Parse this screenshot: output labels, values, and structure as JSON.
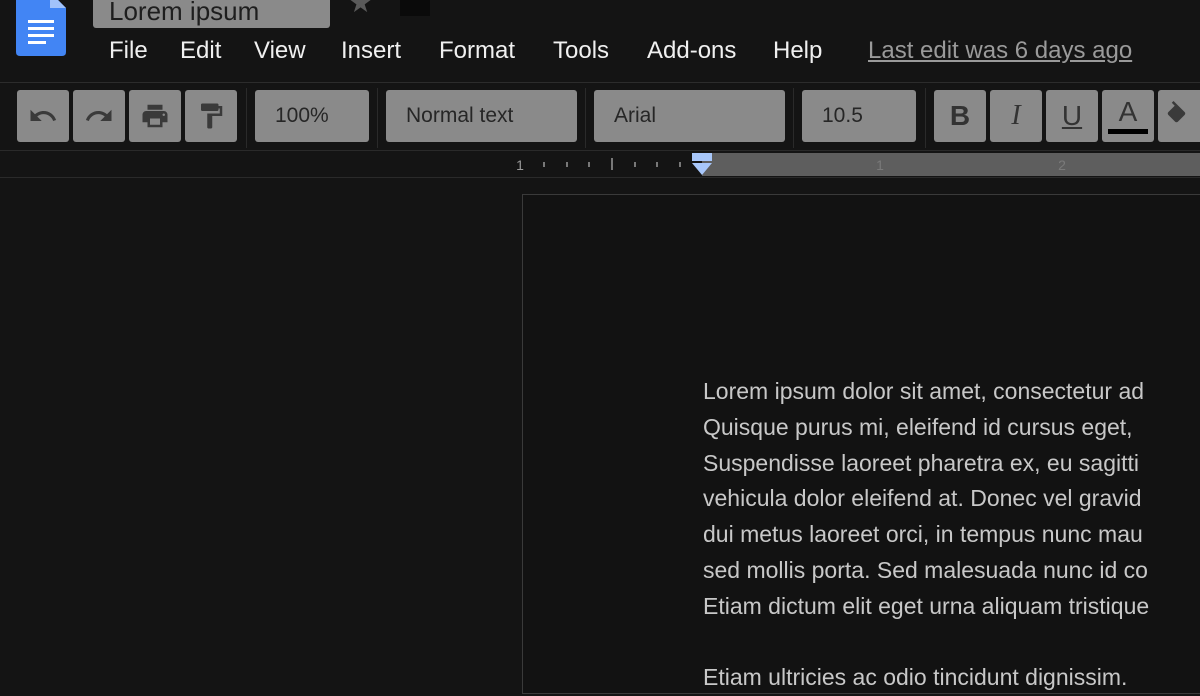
{
  "header": {
    "doc_title": "Lorem ipsum",
    "last_edit": "Last edit was 6 days ago"
  },
  "menu": [
    {
      "label": "File"
    },
    {
      "label": "Edit"
    },
    {
      "label": "View"
    },
    {
      "label": "Insert"
    },
    {
      "label": "Format"
    },
    {
      "label": "Tools"
    },
    {
      "label": "Add-ons"
    },
    {
      "label": "Help"
    }
  ],
  "toolbar": {
    "icons": [
      "undo-icon",
      "redo-icon",
      "print-icon",
      "paint-format-icon"
    ],
    "zoom": "100%",
    "style": "Normal text",
    "font": "Arial",
    "font_size": "10.5",
    "bold": "B",
    "italic": "I",
    "underline": "U",
    "text_color": "A",
    "text_color_value": "#000000"
  },
  "ruler": {
    "labels": [
      "1",
      "1",
      "2"
    ]
  },
  "document": {
    "paragraphs": [
      [
        "Lorem ipsum dolor sit amet, consectetur ad",
        "Quisque purus mi, eleifend id cursus eget, ",
        "Suspendisse laoreet pharetra ex, eu sagitti",
        "vehicula dolor eleifend at. Donec vel gravid",
        "dui metus laoreet orci, in tempus nunc mau",
        "sed mollis porta. Sed malesuada nunc id co",
        "Etiam dictum elit eget urna aliquam tristique"
      ],
      [
        "Etiam ultricies ac odio tincidunt dignissim. "
      ]
    ]
  },
  "colors": {
    "background": "#141414",
    "button": "#8a8a8a",
    "logo_blue": "#4285f4",
    "ruler_marker": "#a8c7fa"
  }
}
